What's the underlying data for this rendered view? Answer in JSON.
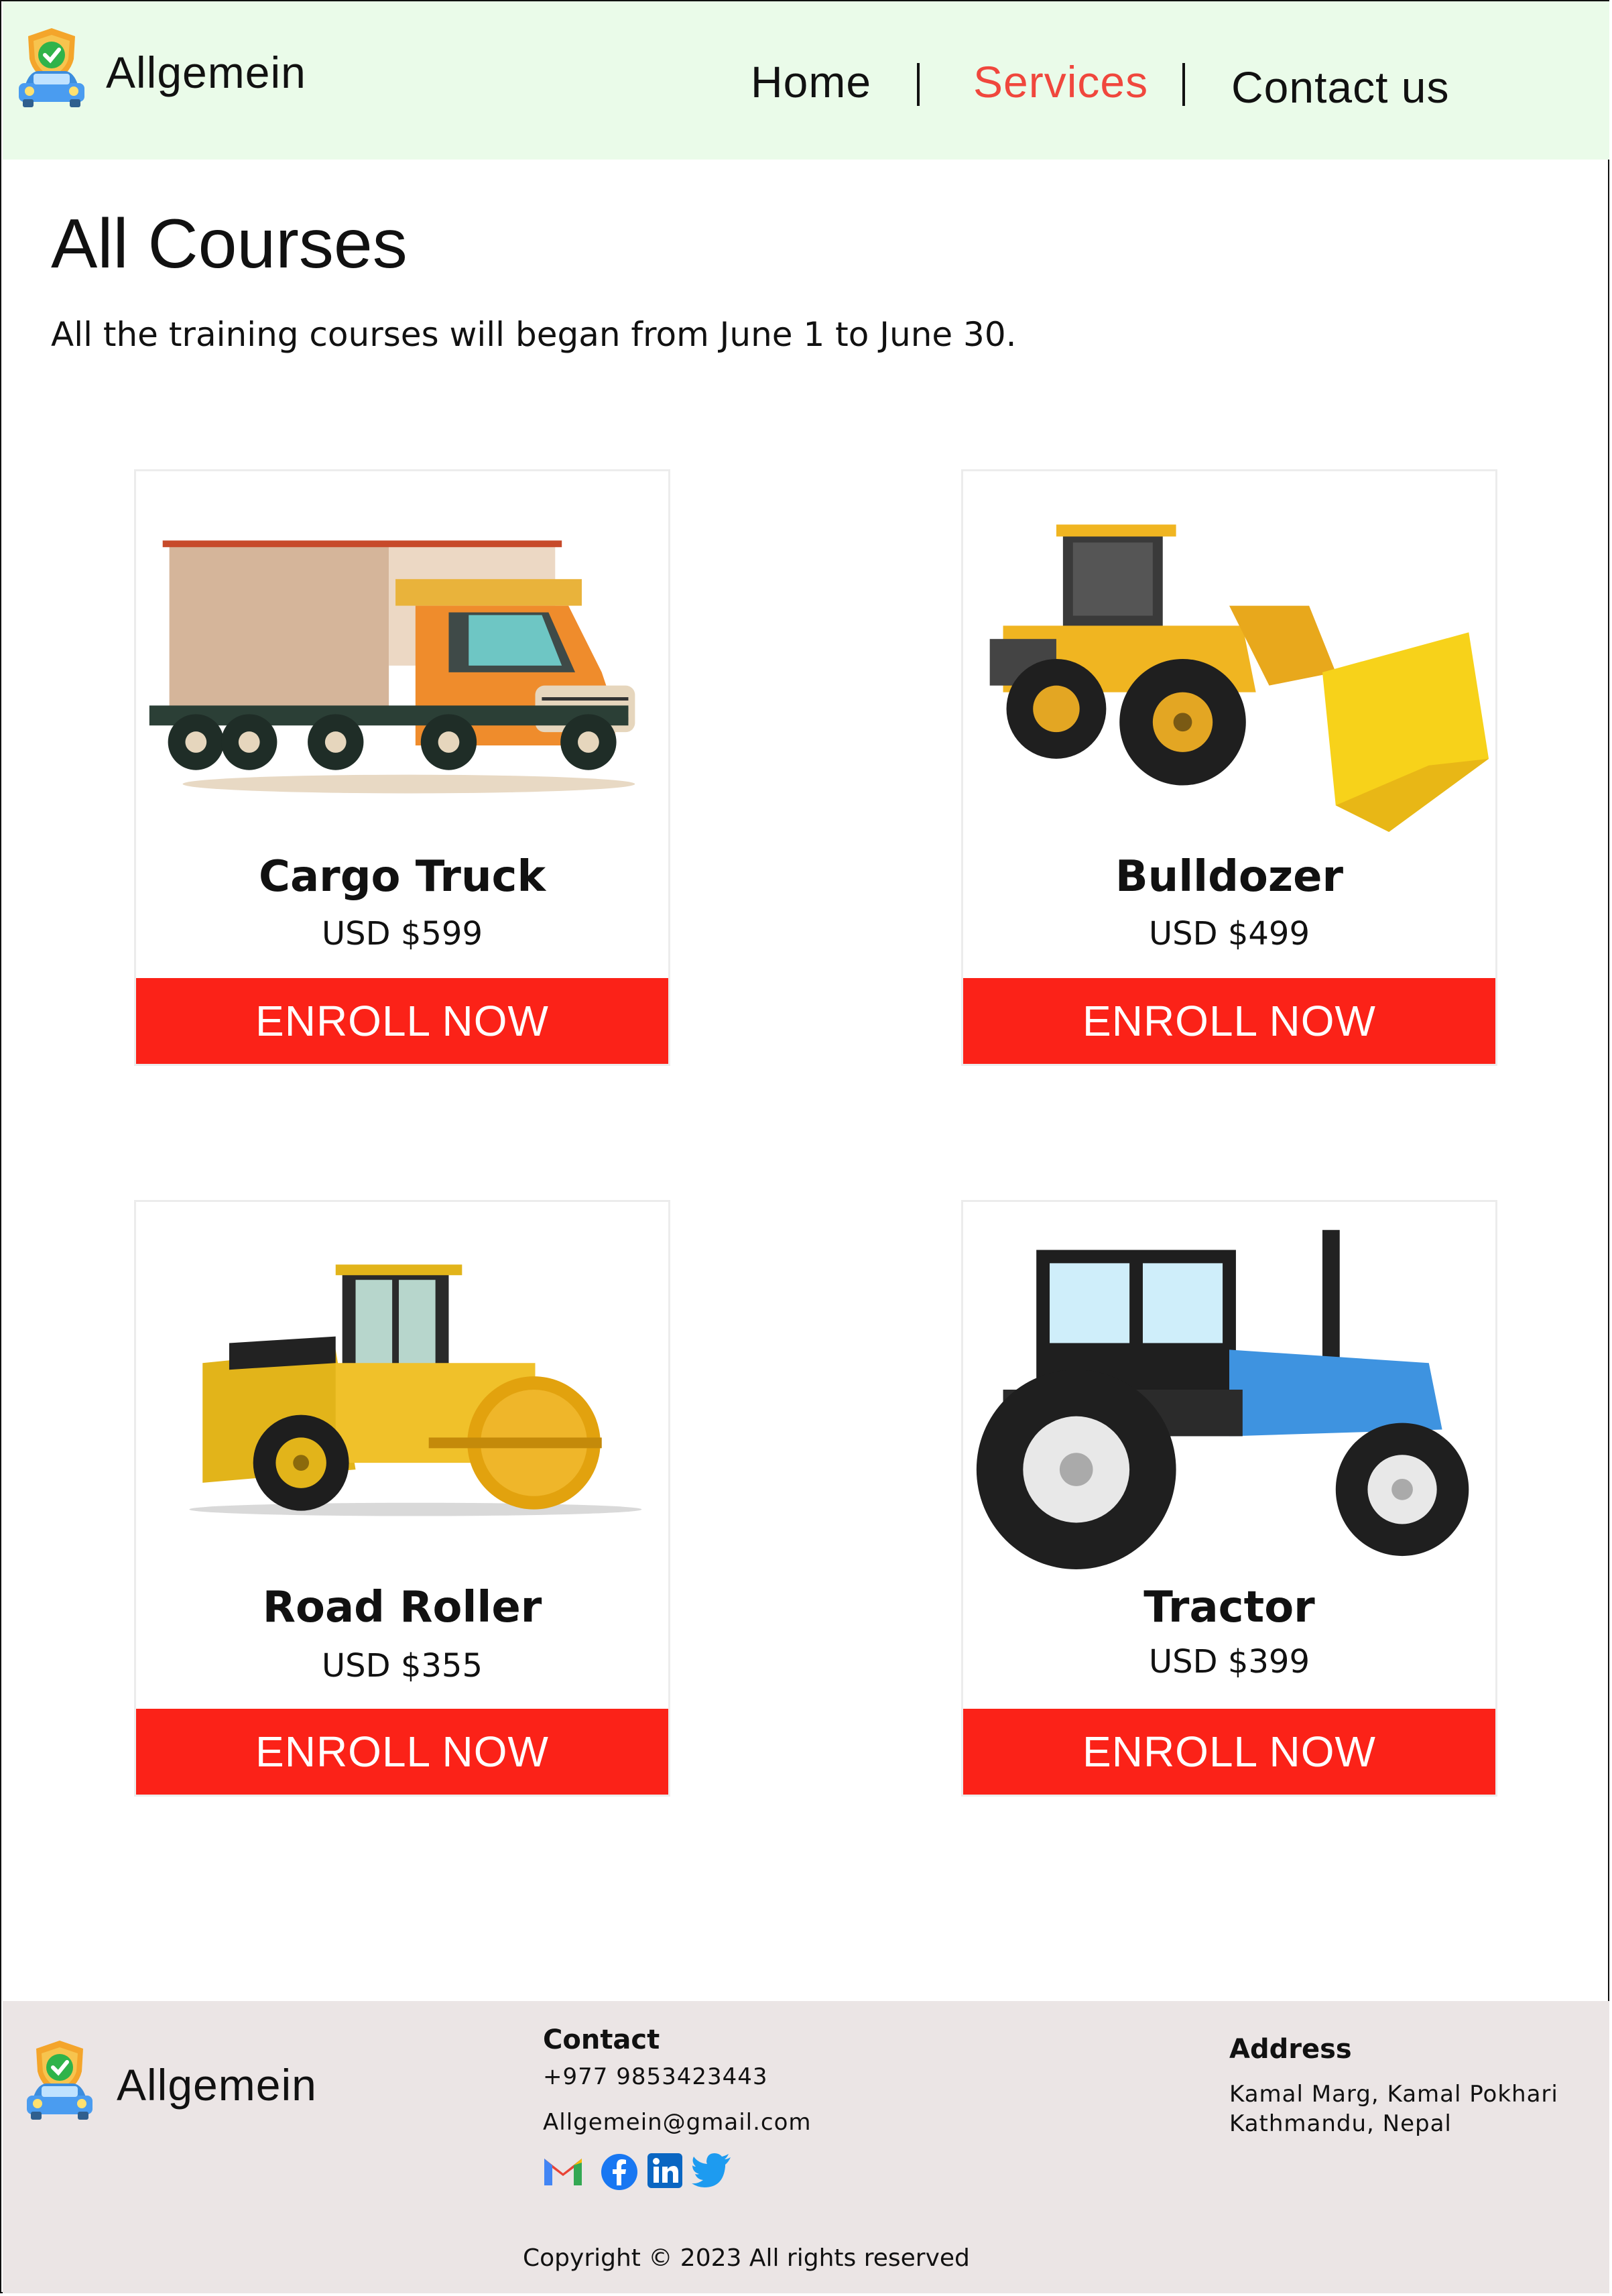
{
  "header": {
    "brand": "Allgemein",
    "nav": [
      {
        "label": "Home"
      },
      {
        "label": "Services",
        "active": true
      },
      {
        "label": "Contact us"
      }
    ],
    "active_color": "#f0473d",
    "background": "#eafbe9"
  },
  "main": {
    "title": "All Courses",
    "subtitle": "All the training courses will began from June 1 to June 30.",
    "courses": [
      {
        "name": "Cargo Truck",
        "price": "USD $599",
        "button": "ENROLL NOW",
        "icon": "cargo-truck-image"
      },
      {
        "name": "Bulldozer",
        "price": "USD $499",
        "button": "ENROLL NOW",
        "icon": "bulldozer-image"
      },
      {
        "name": "Road Roller",
        "price": "USD $355",
        "button": "ENROLL NOW",
        "icon": "road-roller-image"
      },
      {
        "name": "Tractor",
        "price": "USD $399",
        "button": "ENROLL NOW",
        "icon": "tractor-image"
      }
    ],
    "button_color": "#fb2218"
  },
  "footer": {
    "brand": "Allgemein",
    "contact_heading": "Contact",
    "phone": "+977 9853423443",
    "email": "Allgemein@gmail.com",
    "social_icons": [
      "gmail-icon",
      "facebook-icon",
      "linkedin-icon",
      "twitter-icon"
    ],
    "address_heading": "Address",
    "address_line1": "Kamal Marg, Kamal Pokhari",
    "address_line2": "Kathmandu, Nepal",
    "copyright": "Copyright © 2023 All rights reserved",
    "background": "#ebe5e5"
  }
}
